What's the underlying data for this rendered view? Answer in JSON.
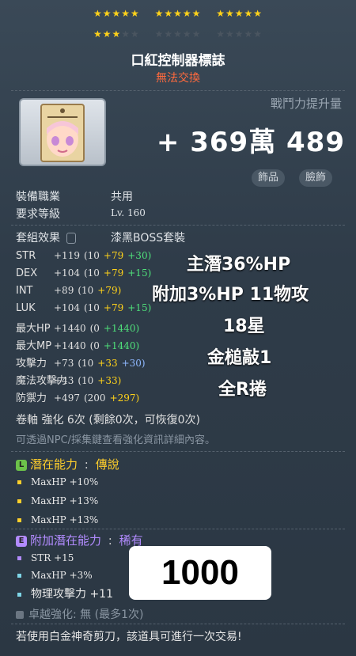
{
  "stars": {
    "row1": [
      "★★★★★",
      "★★★★★",
      "★★★★★"
    ],
    "row2_on": "★★★",
    "row2_off1": "★★",
    "row2_off2": "★★★★★",
    "row2_off3": "★★★★★"
  },
  "item": {
    "name": "口紅控制器標誌",
    "trade_status": "無法交換"
  },
  "power": {
    "label": "戰鬥力提升量",
    "value": "+ 369萬 489"
  },
  "tags": [
    "飾品",
    "臉飾"
  ],
  "info": {
    "job_label": "裝備職業",
    "job_value": "共用",
    "level_label": "要求等級",
    "level_value": "Lv. 160",
    "set_label": "套組效果",
    "set_value": "漆黑BOSS套裝"
  },
  "stats": [
    {
      "key": "STR",
      "total": "+119",
      "base": "(10",
      "add": "+79",
      "extra": "+30)",
      "extra_color": "green"
    },
    {
      "key": "DEX",
      "total": "+104",
      "base": "(10",
      "add": "+79",
      "extra": "+15)",
      "extra_color": "green"
    },
    {
      "key": "INT",
      "total": "+89",
      "base": "(10",
      "add": "+79)",
      "extra": "",
      "extra_color": "green"
    },
    {
      "key": "LUK",
      "total": "+104",
      "base": "(10",
      "add": "+79",
      "extra": "+15)",
      "extra_color": "green"
    },
    {
      "key": "最大HP",
      "total": "+1440",
      "base": "(0",
      "add": "",
      "extra": "+1440)",
      "extra_color": "green"
    },
    {
      "key": "最大MP",
      "total": "+1440",
      "base": "(0",
      "add": "",
      "extra": "+1440)",
      "extra_color": "green"
    },
    {
      "key": "攻擊力",
      "total": "+73",
      "base": "(10",
      "add": "+33",
      "extra": "+30)",
      "extra_color": "blue"
    },
    {
      "key": "魔法攻擊力",
      "total": "+43",
      "base": "(10",
      "add": "+33)",
      "extra": "",
      "extra_color": "green"
    },
    {
      "key": "防禦力",
      "total": "+497",
      "base": "(200",
      "add": "+297)",
      "extra": "",
      "extra_color": "green"
    }
  ],
  "overlay_notes": [
    "主潛36%HP",
    "附加3%HP 11物攻",
    "18星",
    "金槌敲1",
    "全R捲"
  ],
  "scroll": {
    "text": "卷軸 強化 6次 (剩餘0次，可恢復0次)",
    "hint": "可透過NPC/採集鍵查看強化資訊詳細內容。"
  },
  "potential": {
    "icon": "L",
    "label": "潛在能力",
    "sep": ":",
    "grade": "傳說",
    "lines": [
      "MaxHP +10%",
      "MaxHP +13%",
      "MaxHP +13%"
    ]
  },
  "additional": {
    "icon": "E",
    "label": "附加潛在能力",
    "sep": ":",
    "grade": "稀有",
    "lines": [
      "STR +15",
      "MaxHP +3%",
      "物理攻擊力 +11"
    ]
  },
  "price": "1000",
  "excellence": "卓越強化:  無 (最多1次)",
  "footer": "若使用白金神奇剪刀，該道具可進行一次交易!",
  "colors": {
    "star": "#ffd21a",
    "trade": "#ff6a3d",
    "legend": "#ffcf2b",
    "epic": "#b28bff",
    "green": "#4fe07a",
    "yellow": "#ffd21a",
    "blue": "#8fb8ff"
  }
}
